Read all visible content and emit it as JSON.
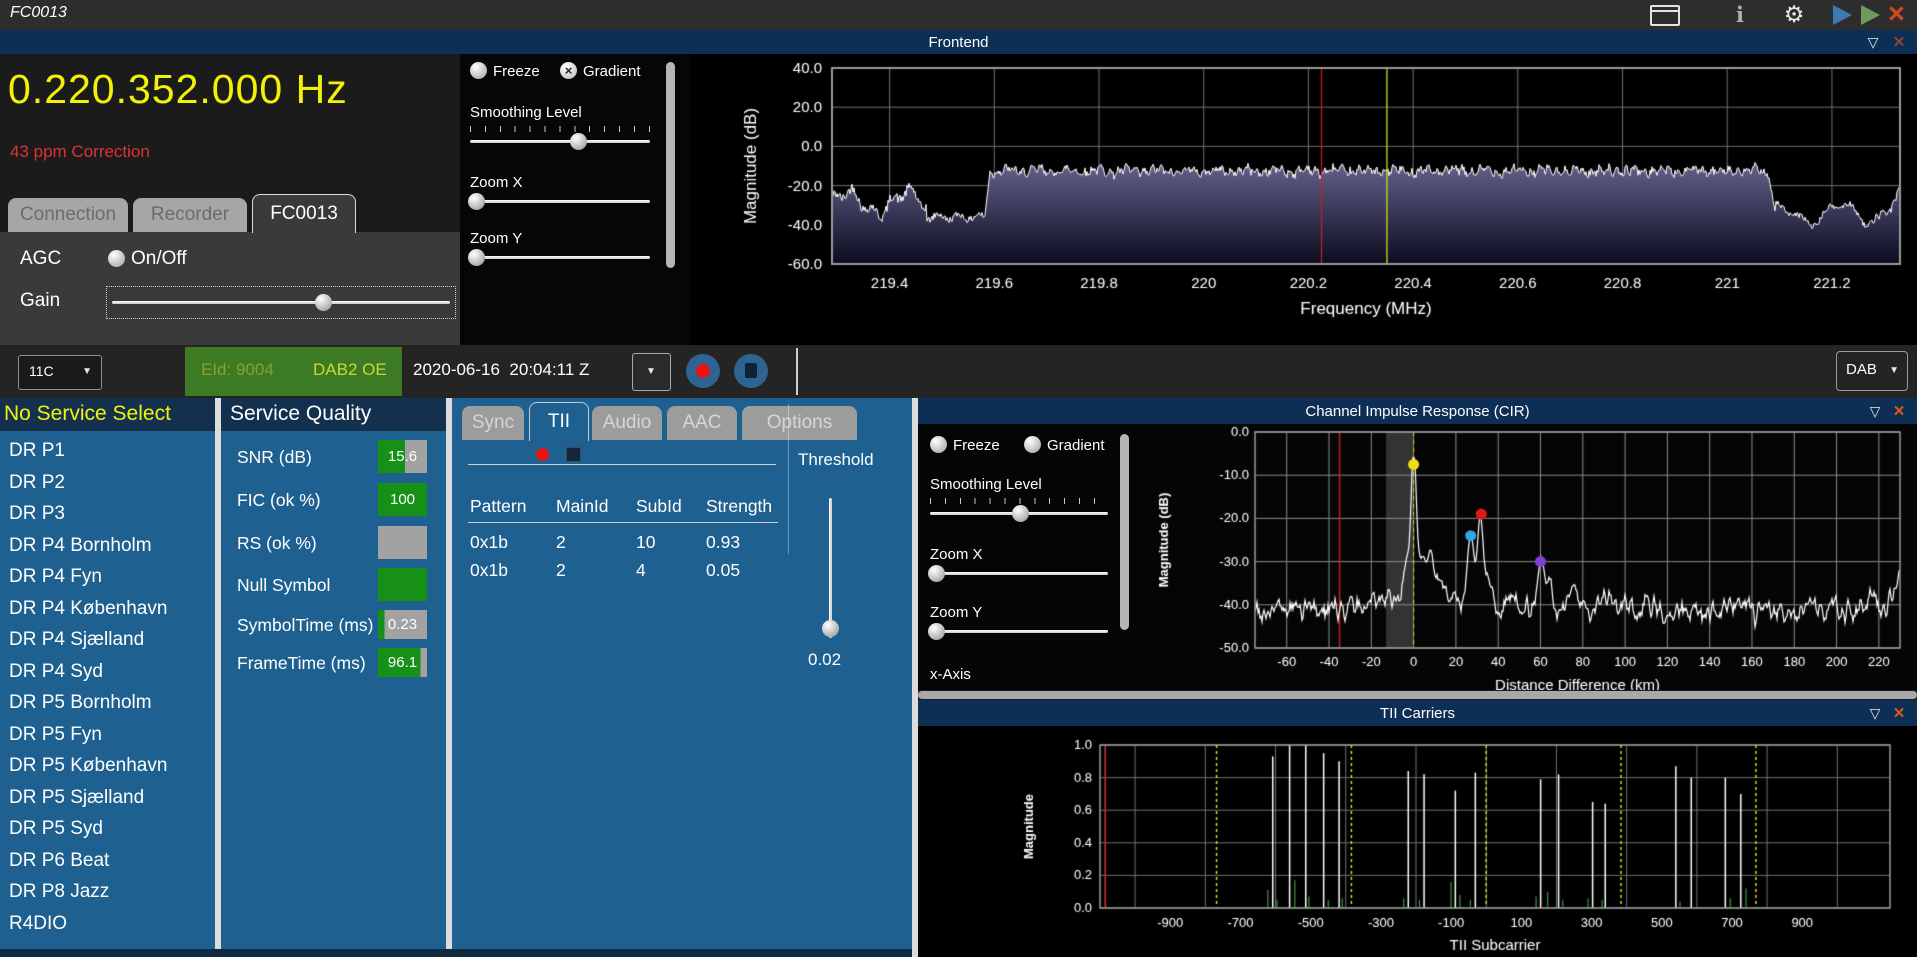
{
  "titlebar": {
    "title": "FC0013"
  },
  "frontend": {
    "header": "Frontend",
    "frequency": "0.220.352.000 Hz",
    "correction": "43 ppm Correction",
    "tabs": [
      "Connection",
      "Recorder",
      "FC0013"
    ],
    "agc_label": "AGC",
    "agc_option": "On/Off",
    "gain_label": "Gain",
    "controls": {
      "freeze": "Freeze",
      "gradient": "Gradient",
      "smoothing": "Smoothing Level",
      "zoom_x": "Zoom X",
      "zoom_y": "Zoom Y"
    }
  },
  "channel_bar": {
    "channel": "11C",
    "eid": "EId: 9004",
    "ensemble": "DAB2 OE",
    "datetime": "2020-06-16  20:04:11 Z",
    "mode": "DAB"
  },
  "services": {
    "header": "No Service Select",
    "items": [
      "DR P1",
      "DR P2",
      "DR P3",
      "DR P4 Bornholm",
      "DR P4 Fyn",
      "DR P4 København",
      "DR P4 Sjælland",
      "DR P4 Syd",
      "DR P5 Bornholm",
      "DR P5 Fyn",
      "DR P5 København",
      "DR P5 Sjælland",
      "DR P5 Syd",
      "DR P6 Beat",
      "DR P8 Jazz",
      "R4DIO"
    ]
  },
  "quality": {
    "header": "Service Quality",
    "rows": [
      {
        "label": "SNR (dB)",
        "value": "15.6",
        "green_pct": 55
      },
      {
        "label": "FIC (ok %)",
        "value": "100",
        "green_pct": 100
      },
      {
        "label": "RS (ok %)",
        "value": "",
        "green_pct": 0
      },
      {
        "label": "Null Symbol",
        "value": "",
        "green_pct": 100
      },
      {
        "label": "SymbolTime (ms)",
        "value": "0.23",
        "green_pct": 13
      },
      {
        "label": "FrameTime (ms)",
        "value": "96.1",
        "green_pct": 87
      }
    ]
  },
  "decoder": {
    "tabs": [
      "Sync",
      "TII",
      "Audio",
      "AAC",
      "Options"
    ],
    "table_headers": [
      "Pattern",
      "MainId",
      "SubId",
      "Strength"
    ],
    "table_rows": [
      [
        "0x1b",
        "2",
        "10",
        "0.93"
      ],
      [
        "0x1b",
        "2",
        "4",
        "0.05"
      ]
    ],
    "threshold_label": "Threshold",
    "threshold_value": "0.02"
  },
  "cir": {
    "header": "Channel Impulse Response (CIR)",
    "controls": {
      "freeze": "Freeze",
      "gradient": "Gradient",
      "smoothing": "Smoothing Level",
      "zoom_x": "Zoom X",
      "zoom_y": "Zoom Y",
      "x_axis": "x-Axis"
    }
  },
  "tii_carriers": {
    "header": "TII Carriers"
  },
  "chart_data": [
    {
      "id": "spectrum",
      "type": "area",
      "title": "Frontend",
      "xlabel": "Frequency (MHz)",
      "ylabel": "Magnitude (dB)",
      "xlim": [
        219.29,
        221.33
      ],
      "ylim": [
        -60,
        40
      ],
      "xticks": {
        "values": [
          219.4,
          219.6,
          219.8,
          220,
          220.2,
          220.4,
          220.6,
          220.8,
          221,
          221.2
        ],
        "labels": [
          "219.4",
          "219.6",
          "219.8",
          "220",
          "220.2",
          "220.4",
          "220.6",
          "220.8",
          "221",
          "221.2"
        ]
      },
      "yticks": {
        "values": [
          40,
          20,
          0,
          -20,
          -40,
          -60
        ],
        "labels": [
          "40.0",
          "20.0",
          "0.0",
          "-20.0",
          "-40.0",
          "-60.0"
        ]
      },
      "signal": {
        "noise_floor_db": -36,
        "plateau_db": -12.5,
        "plateau_start_mhz": 219.588,
        "plateau_end_mhz": 221.082
      },
      "cursors": [
        {
          "x": 220.225,
          "color": "#c81e1e"
        },
        {
          "x": 220.35,
          "color": "#d8d820"
        }
      ]
    },
    {
      "id": "cir",
      "type": "line",
      "xlabel": "Distance Difference (km)",
      "ylabel": "Magnitude (dB)",
      "xlim": [
        -75,
        230
      ],
      "ylim": [
        -50,
        0
      ],
      "xticks": {
        "values": [
          -60,
          -40,
          -20,
          0,
          20,
          40,
          60,
          80,
          100,
          120,
          140,
          160,
          180,
          200,
          220
        ],
        "labels": [
          "-60",
          "-40",
          "-20",
          "0",
          "20",
          "40",
          "60",
          "80",
          "100",
          "120",
          "140",
          "160",
          "180",
          "200",
          "220"
        ]
      },
      "yticks": {
        "values": [
          0,
          -10,
          -20,
          -30,
          -40,
          -50
        ],
        "labels": [
          "0.0",
          "-10.0",
          "-20.0",
          "-30.0",
          "-40.0",
          "-50.0"
        ]
      },
      "noise_floor_db": -41,
      "highlight_band": [
        -13,
        0
      ],
      "cursor": {
        "x": -35,
        "color": "#c81e1e"
      },
      "zero_line": {
        "x": 0,
        "color": "#d8d820"
      },
      "peaks": [
        {
          "x": 0,
          "y": -7.5,
          "marker": "#f0e010"
        },
        {
          "x": 27,
          "y": -24,
          "marker": "#30a8e8"
        },
        {
          "x": 32,
          "y": -19,
          "marker": "#e01818"
        },
        {
          "x": 60,
          "y": -30,
          "marker": "#8040d8"
        }
      ]
    },
    {
      "id": "tii",
      "type": "stem",
      "xlabel": "TII Subcarrier",
      "ylabel": "Magnitude",
      "xlim": [
        -1100,
        1150
      ],
      "ylim": [
        0,
        1
      ],
      "xticks": {
        "values": [
          -900,
          -700,
          -500,
          -300,
          -100,
          100,
          300,
          500,
          700,
          900
        ],
        "labels": [
          "-900",
          "-700",
          "-500",
          "-300",
          "-100",
          "100",
          "300",
          "500",
          "700",
          "900"
        ]
      },
      "yticks": {
        "values": [
          1,
          0.8,
          0.6,
          0.4,
          0.2,
          0
        ],
        "labels": [
          "1.0",
          "0.8",
          "0.6",
          "0.4",
          "0.2",
          "0.0"
        ]
      },
      "null_markers": [
        -768,
        -384,
        0,
        384,
        768
      ],
      "edge_cursor": {
        "x": -1085,
        "color": "#c83030"
      },
      "spikes": [
        [
          -608,
          0.93
        ],
        [
          -560,
          1.0
        ],
        [
          -514,
          1.0
        ],
        [
          -463,
          0.95
        ],
        [
          -419,
          0.9
        ],
        [
          -222,
          0.84
        ],
        [
          -177,
          0.82
        ],
        [
          -88,
          0.72
        ],
        [
          -31,
          0.83
        ],
        [
          155,
          0.79
        ],
        [
          206,
          0.82
        ],
        [
          303,
          0.65
        ],
        [
          339,
          0.64
        ],
        [
          540,
          0.87
        ],
        [
          584,
          0.8
        ],
        [
          681,
          0.8
        ],
        [
          725,
          0.7
        ]
      ],
      "minor_spikes": [
        [
          -622,
          0.11
        ],
        [
          -596,
          0.05
        ],
        [
          -545,
          0.17
        ],
        [
          -505,
          0.07
        ],
        [
          -450,
          0.05
        ],
        [
          -410,
          0.06
        ],
        [
          -235,
          0.06
        ],
        [
          -190,
          0.05
        ],
        [
          -100,
          0.16
        ],
        [
          -75,
          0.08
        ],
        [
          -45,
          0.05
        ],
        [
          142,
          0.07
        ],
        [
          175,
          0.1
        ],
        [
          218,
          0.05
        ],
        [
          290,
          0.06
        ],
        [
          330,
          0.05
        ],
        [
          552,
          0.04
        ],
        [
          695,
          0.06
        ],
        [
          740,
          0.12
        ]
      ]
    }
  ]
}
